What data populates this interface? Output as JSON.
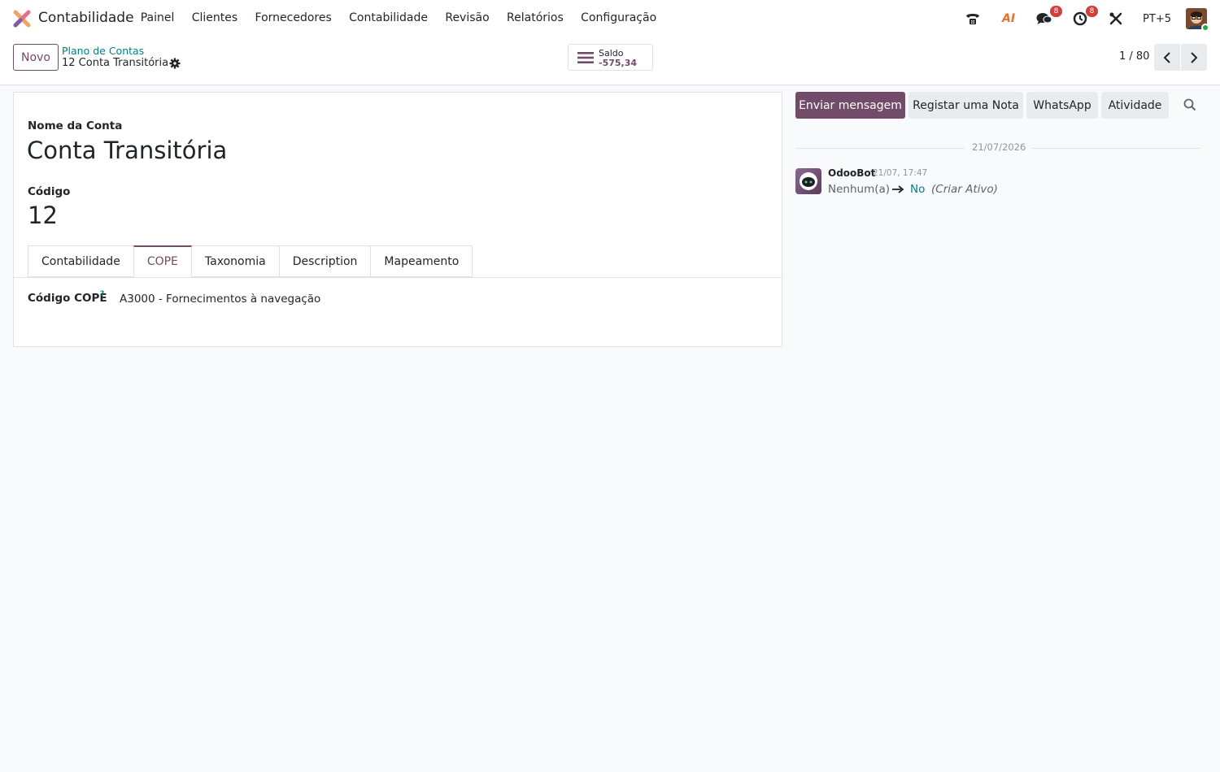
{
  "navbar": {
    "app_name": "Contabilidade",
    "menu": [
      "Painel",
      "Clientes",
      "Fornecedores",
      "Contabilidade",
      "Revisão",
      "Relatórios",
      "Configuração"
    ],
    "ai_label": "AI",
    "messages_badge": "8",
    "activities_badge": "8",
    "company": "PT+5"
  },
  "control_panel": {
    "new_label": "Novo",
    "breadcrumb_parent": "Plano de Contas",
    "breadcrumb_current": "12 Conta Transitória",
    "balance_label": "Saldo",
    "balance_value": "-575,34",
    "pager": "1 / 80"
  },
  "form": {
    "name_label": "Nome da Conta",
    "name_value": "Conta Transitória",
    "code_label": "Código",
    "code_value": "12",
    "tabs": [
      {
        "label": "Contabilidade"
      },
      {
        "label": "COPE"
      },
      {
        "label": "Taxonomia"
      },
      {
        "label": "Description"
      },
      {
        "label": "Mapeamento"
      }
    ],
    "cope_label": "Código COPE",
    "cope_help": "?",
    "cope_value": "A3000 - Fornecimentos à navegação"
  },
  "chatter": {
    "send_message": "Enviar mensagem",
    "log_note": "Registar uma Nota",
    "whatsapp": "WhatsApp",
    "activity": "Atividade",
    "date_separator": "21/07/2026",
    "message": {
      "author": "OdooBot",
      "date": "21/07, 17:47",
      "old_value": "Nenhum(a)",
      "new_value": "No",
      "field": "(Criar Ativo)"
    }
  },
  "colors": {
    "primary": "#714b67",
    "link": "#017e84",
    "badge": "#d23f3a"
  }
}
